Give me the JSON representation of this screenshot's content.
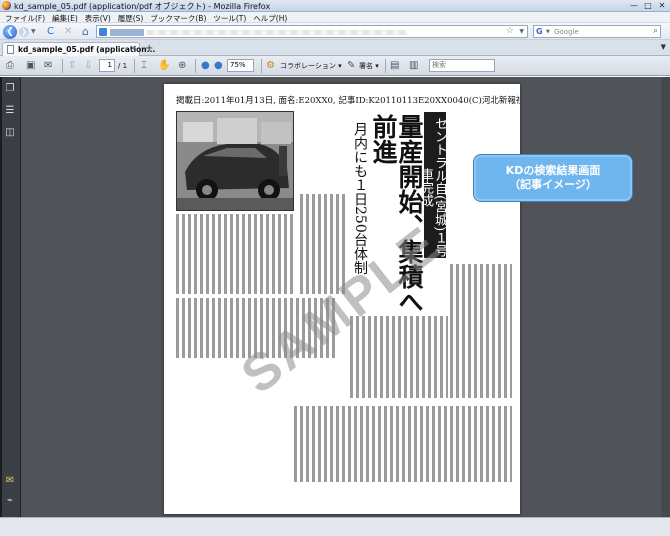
{
  "window": {
    "title": "kd_sample_05.pdf (application/pdf オブジェクト) - Mozilla Firefox",
    "controls": {
      "minimize": "—",
      "maximize": "□",
      "close": "✕"
    }
  },
  "menubar": {
    "items": [
      {
        "label": "ファイル(F)"
      },
      {
        "label": "編集(E)"
      },
      {
        "label": "表示(V)"
      },
      {
        "label": "履歴(S)"
      },
      {
        "label": "ブックマーク(B)"
      },
      {
        "label": "ツール(T)"
      },
      {
        "label": "ヘルプ(H)"
      }
    ]
  },
  "navbar": {
    "back": "❮",
    "forward": "❯",
    "dropdown": "▼",
    "reload": "C",
    "stop": "✕",
    "home": "⌂",
    "url_star": "☆",
    "url_dropdown": "▼",
    "search_engine": "G",
    "search_placeholder": "Google",
    "search_icon": "⌕"
  },
  "tabbar": {
    "tabs": [
      {
        "label": "kd_sample_05.pdf (application...",
        "close": "✕"
      }
    ],
    "new_tab": "+",
    "list_tabs": "▼"
  },
  "pdf_toolbar": {
    "page_current": "1",
    "page_total": "/ 1",
    "zoom": "75%",
    "collaboration_label": "コラボレーション ▾",
    "sign_label": "署名 ▾",
    "search_placeholder": "検索",
    "icons": [
      "print-icon",
      "save-icon",
      "email-icon",
      "prev-page-icon",
      "next-page-icon",
      "select-icon",
      "hand-icon",
      "marquee-zoom-icon",
      "zoom-out-icon",
      "zoom-in-icon",
      "collaboration-icon",
      "sign-icon",
      "fit-page-icon",
      "fit-width-icon"
    ]
  },
  "sidebar": {
    "icons": [
      "pages-icon",
      "bookmarks-icon",
      "layers-icon",
      "comments-icon",
      "attachments-icon"
    ]
  },
  "document": {
    "header": "掲載日:2011年01月13日, 面名:E20XX0, 記事ID:K20110113E20XX0040(C)河北新報社",
    "headline_box": "セントラル自(宮城)１号車完成",
    "headline_main": "量産開始、集積へ前進",
    "headline_sub": "月内にも１日250台体制",
    "watermark": "SAMPLE"
  },
  "callout": {
    "line1": "KDの検索結果画面",
    "line2": "（記事イメージ）"
  },
  "colors": {
    "viewer_bg": "#505357",
    "callout_bg": "#6fb5ee",
    "sidebar_bg": "#3a3e45"
  }
}
